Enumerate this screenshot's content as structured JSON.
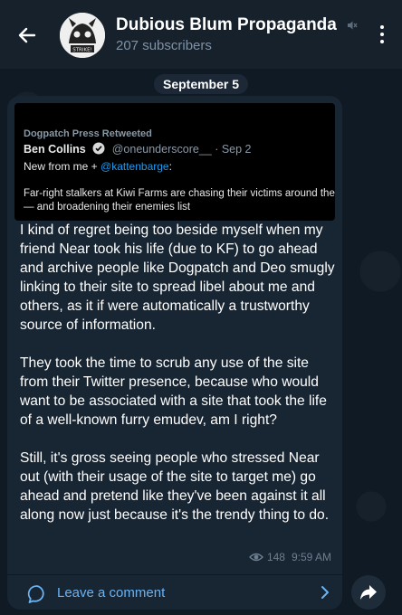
{
  "header": {
    "title": "Dubious Blum Propaganda",
    "subtitle": "207 subscribers",
    "avatar_caption": "STRIKE!"
  },
  "date_label": "September 5",
  "tweet": {
    "retweeted_label": "Dogpatch Press Retweeted",
    "author": "Ben Collins",
    "handle_time": "@oneunderscore__ · Sep 2",
    "line1_prefix": "New from me + ",
    "mention": "@kattenbarge",
    "line1_suffix": ":",
    "line2": "Far-right stalkers at Kiwi Farms are chasing their victims around the",
    "line3": "— and broadening their enemies list"
  },
  "message": {
    "paragraphs": [
      "I kind of regret being too beside myself when my friend Near took his life (due to KF) to go ahead and archive people like Dogpatch and Deo smugly linking to their site to spread libel about me and others, as it if were automatically a trustworthy source of information.",
      "They took the time to scrub any use of the site from their Twitter presence, because who would want to be associated with a site that took the life of a well-known furry emudev, am I right?",
      "Still, it's gross seeing people who stressed Near out (with their usage of the site to target me) go ahead and pretend like they've been against it all along now just because it's the trendy thing to do."
    ],
    "views": "148",
    "time": "9:59 AM"
  },
  "comment_label": "Leave a comment",
  "colors": {
    "header_bg": "#17212b",
    "bubble_bg": "#182533",
    "accent": "#6ab3f3",
    "muted_text": "#7f91a4"
  },
  "icons": [
    "back-arrow-icon",
    "muted-speaker-icon",
    "more-vertical-icon",
    "verified-badge-icon",
    "eye-icon",
    "comment-bubble-icon",
    "chevron-right-icon",
    "share-arrow-icon"
  ]
}
